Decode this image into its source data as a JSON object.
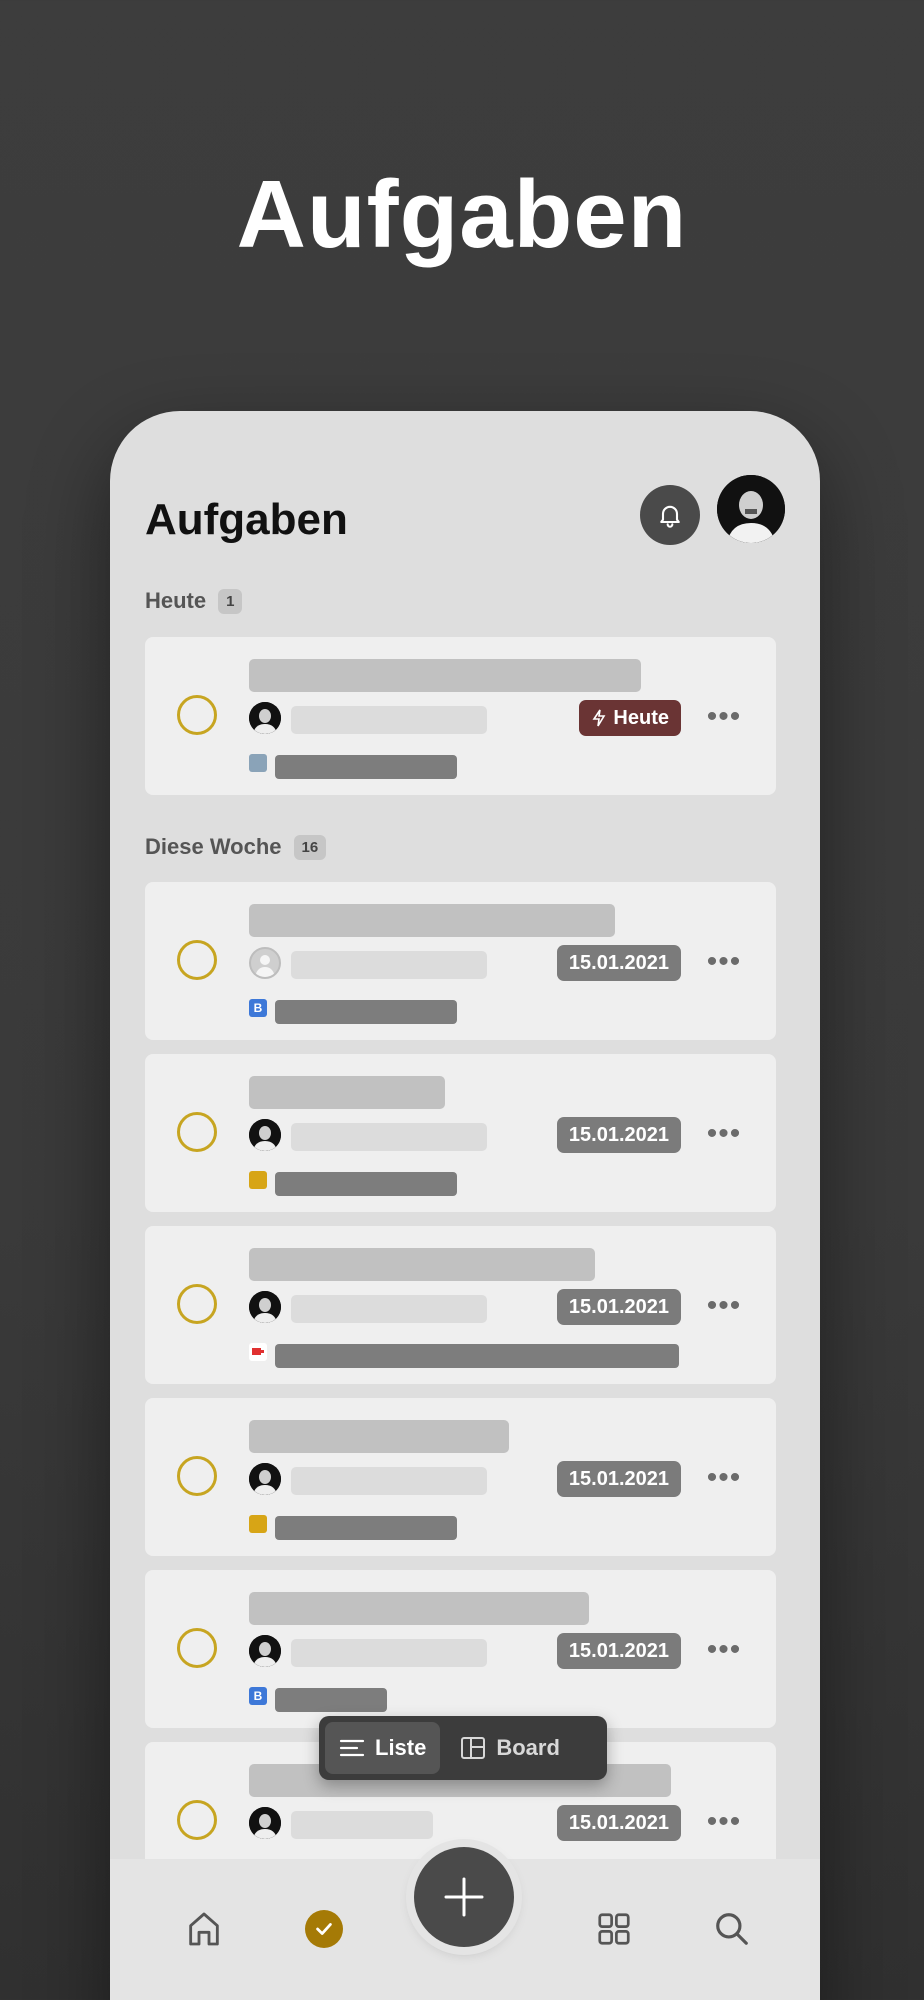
{
  "hero": {
    "title": "Aufgaben"
  },
  "app": {
    "title": "Aufgaben",
    "accent_check": "#c7a521",
    "today_color": "#6a3434",
    "date_color": "#7b7b7b"
  },
  "sections": {
    "today": {
      "label": "Heute",
      "count": "1"
    },
    "week": {
      "label": "Diese Woche",
      "count": "16"
    }
  },
  "tasks": [
    {
      "badge": "Heute",
      "badge_type": "today",
      "project_icon": "photo-thumb-icon"
    },
    {
      "badge": "15.01.2021",
      "badge_type": "date",
      "project_icon": "b-letter-icon",
      "project_letter": "B"
    },
    {
      "badge": "15.01.2021",
      "badge_type": "date",
      "project_icon": "yellow-doc-icon"
    },
    {
      "badge": "15.01.2021",
      "badge_type": "date",
      "project_icon": "red-flag-icon"
    },
    {
      "badge": "15.01.2021",
      "badge_type": "date",
      "project_icon": "yellow-doc-icon"
    },
    {
      "badge": "15.01.2021",
      "badge_type": "date",
      "project_icon": "b-letter-icon",
      "project_letter": "B"
    },
    {
      "badge": "15.01.2021",
      "badge_type": "date"
    }
  ],
  "view_toggle": {
    "list_label": "Liste",
    "board_label": "Board",
    "active": "Liste"
  },
  "bottom_nav": [
    "home-icon",
    "done-check-icon",
    "add-icon",
    "grid-icon",
    "search-icon"
  ]
}
